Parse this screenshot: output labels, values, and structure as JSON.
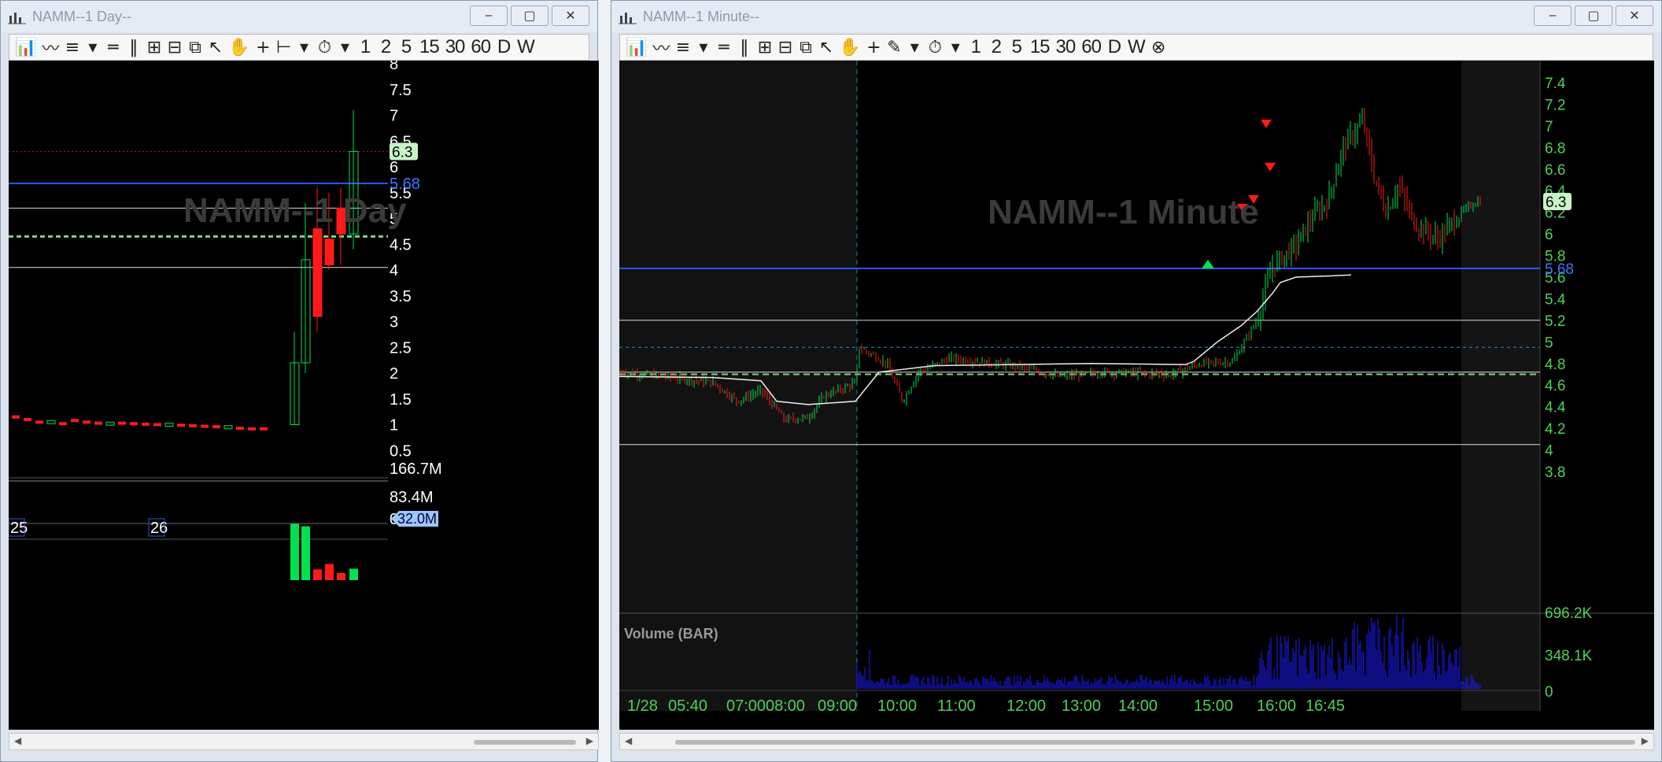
{
  "left_window": {
    "title": "NAMM--1 Day--",
    "controls": [
      "–",
      "▢",
      "✕"
    ],
    "toolbar": [
      "📊",
      "〰",
      "≡",
      "▾",
      "═",
      "‖",
      "⊞",
      "⊟",
      "⧉",
      "↖",
      "✋",
      "+",
      "⊢",
      "▾",
      "⏱",
      "▾",
      "1",
      "2",
      "5",
      "15",
      "30",
      "60",
      "D",
      "W"
    ],
    "watermark": "NAMM--1 Day",
    "price_axis": [
      "8",
      "7.5",
      "7",
      "6.5",
      "6",
      "5.5",
      "5",
      "4.5",
      "4",
      "3.5",
      "3",
      "2.5",
      "2",
      "1.5",
      "1",
      "0.5"
    ],
    "last_price_tag": "6.3",
    "level_tag": "5.68",
    "volume_axis": [
      "166.7M",
      "83.4M",
      "0"
    ],
    "volume_tag": "32.0M",
    "date_labels": [
      "25",
      "26"
    ]
  },
  "right_window": {
    "title": "NAMM--1 Minute--",
    "controls": [
      "–",
      "▢",
      "✕"
    ],
    "toolbar": [
      "📊",
      "〰",
      "≡",
      "▾",
      "═",
      "‖",
      "⊞",
      "⊟",
      "⧉",
      "↖",
      "✋",
      "+",
      "✎",
      "▾",
      "⏱",
      "▾",
      "1",
      "2",
      "5",
      "15",
      "30",
      "60",
      "D",
      "W",
      "⊗"
    ],
    "watermark": "NAMM--1 Minute",
    "price_axis": [
      "7.4",
      "7.2",
      "7",
      "6.8",
      "6.6",
      "6.4",
      "6.2",
      "6",
      "5.8",
      "5.6",
      "5.4",
      "5.2",
      "5",
      "4.8",
      "4.6",
      "4.4",
      "4.2",
      "4",
      "3.8"
    ],
    "last_price_tag": "6.3",
    "level_tag": "5.68",
    "volume_title": "Volume (BAR)",
    "volume_axis": [
      "696.2K",
      "348.1K",
      "0"
    ],
    "time_labels": [
      "1/28",
      "05:40",
      "07:00",
      "08:00",
      "09:00",
      "10:00",
      "11:00",
      "12:00",
      "13:00",
      "14:00",
      "15:00",
      "16:00",
      "16:45"
    ]
  },
  "colors": {
    "up": "#00e050",
    "down": "#ff1a1a",
    "level_blue": "#1f5bff",
    "axis_text_white": "#ffffff",
    "axis_text_green": "#4fd05a",
    "tag_green": "#c8f5c8"
  }
}
